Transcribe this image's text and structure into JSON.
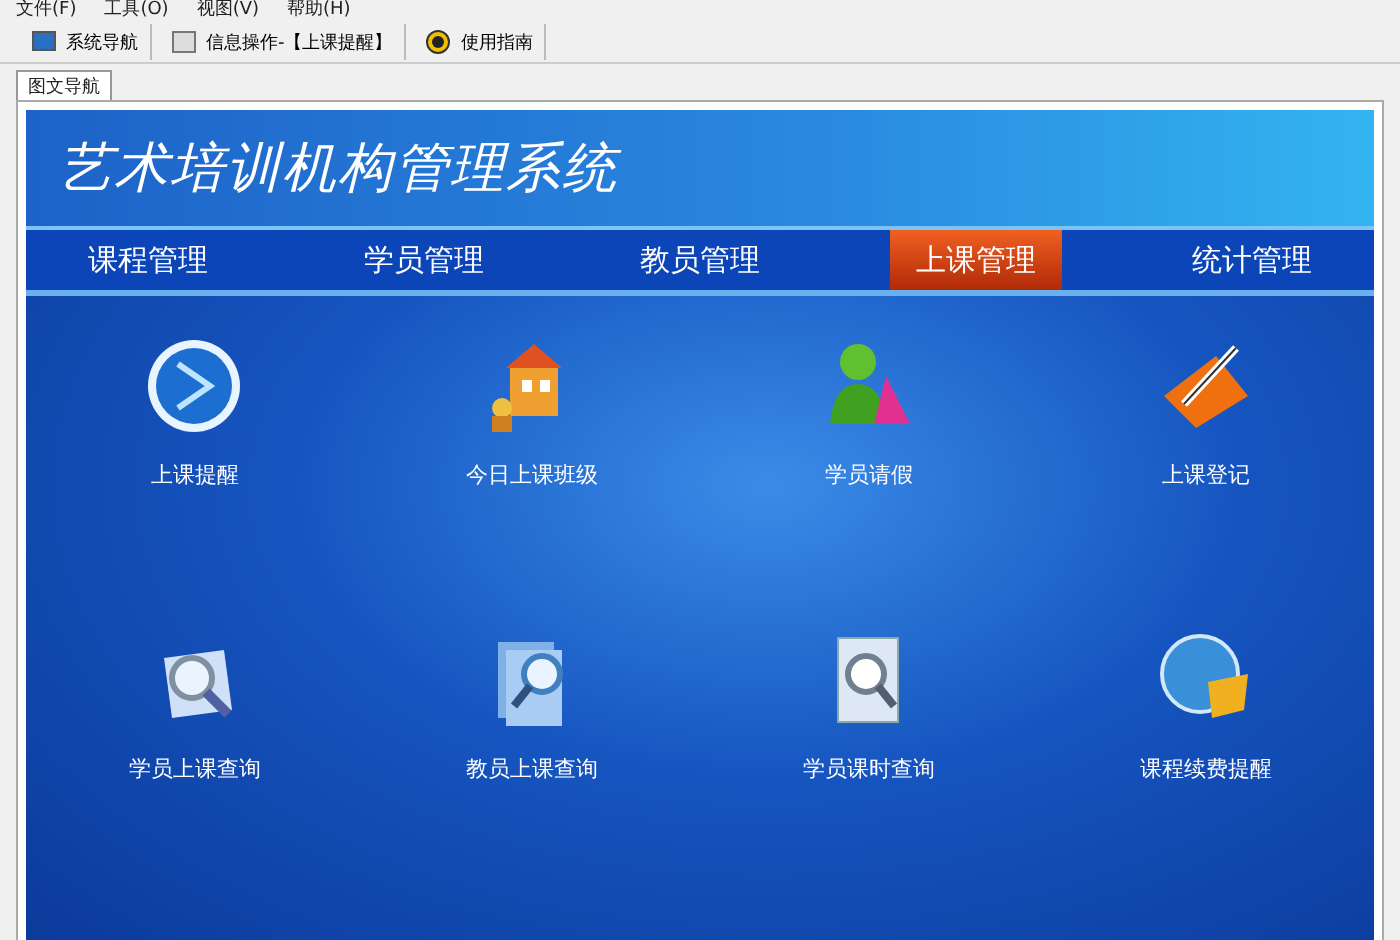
{
  "menu": [
    "文件(F)",
    "工具(O)",
    "视图(V)",
    "帮助(H)"
  ],
  "toolbar": [
    {
      "label": "系统导航"
    },
    {
      "label": "信息操作-【上课提醒】"
    },
    {
      "label": "使用指南"
    }
  ],
  "tabs": [
    {
      "label": "图文导航",
      "selected": true
    }
  ],
  "app_title": "艺术培训机构管理系统",
  "nav": [
    {
      "label": "课程管理",
      "selected": false
    },
    {
      "label": "学员管理",
      "selected": false
    },
    {
      "label": "教员管理",
      "selected": false
    },
    {
      "label": "上课管理",
      "selected": true
    },
    {
      "label": "统计管理",
      "selected": false
    }
  ],
  "tiles": [
    {
      "label": "上课提醒"
    },
    {
      "label": "今日上课班级"
    },
    {
      "label": "学员请假"
    },
    {
      "label": "上课登记"
    },
    {
      "label": "学员上课查询"
    },
    {
      "label": "教员上课查询"
    },
    {
      "label": "学员课时查询"
    },
    {
      "label": "课程续费提醒"
    }
  ]
}
